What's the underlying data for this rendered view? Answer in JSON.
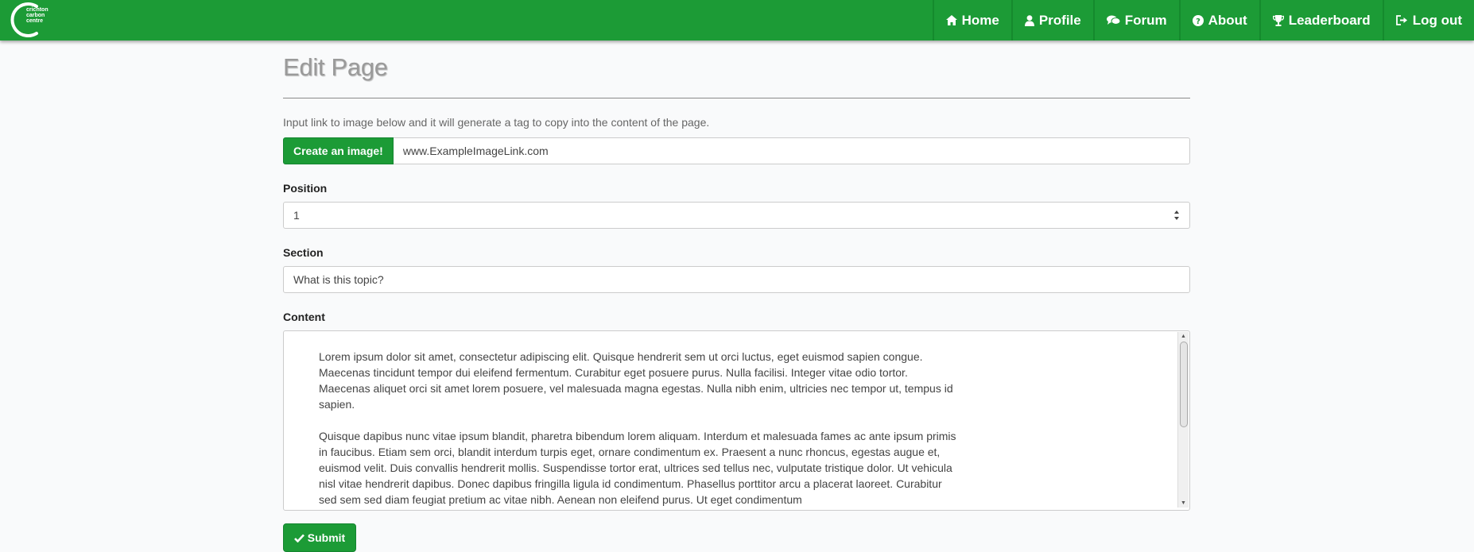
{
  "brand": {
    "logo_lines": [
      "crichton",
      "carbon",
      "centre"
    ],
    "accent_color": "#1c9b36"
  },
  "nav": {
    "items": [
      {
        "label": "Home",
        "icon": "home-icon"
      },
      {
        "label": "Profile",
        "icon": "user-icon"
      },
      {
        "label": "Forum",
        "icon": "comments-icon"
      },
      {
        "label": "About",
        "icon": "question-circle-icon"
      },
      {
        "label": "Leaderboard",
        "icon": "trophy-icon"
      },
      {
        "label": "Log out",
        "icon": "sign-out-icon"
      }
    ]
  },
  "page": {
    "title": "Edit Page",
    "hint": "Input link to image below and it will generate a tag to copy into the content of the page.",
    "create_image_button": "Create an image!",
    "image_link_value": "www.ExampleImageLink.com",
    "position_label": "Position",
    "position_value": "1",
    "section_label": "Section",
    "section_value": "What is this topic?",
    "content_label": "Content",
    "content_paragraphs": [
      "Lorem ipsum dolor sit amet, consectetur adipiscing elit. Quisque hendrerit sem ut orci luctus, eget euismod sapien congue. Maecenas tincidunt tempor dui eleifend fermentum. Curabitur eget posuere purus. Nulla facilisi. Integer vitae odio tortor. Maecenas aliquet orci sit amet lorem posuere, vel malesuada magna egestas. Nulla nibh enim, ultricies nec tempor ut, tempus id sapien.",
      "Quisque dapibus nunc vitae ipsum blandit, pharetra bibendum lorem aliquam. Interdum et malesuada fames ac ante ipsum primis in faucibus. Etiam sem orci, blandit interdum turpis eget, ornare condimentum ex. Praesent a nunc rhoncus, egestas augue et, euismod velit. Duis convallis hendrerit mollis. Suspendisse tortor erat, ultrices sed tellus nec, vulputate tristique dolor. Ut vehicula nisl vitae hendrerit dapibus. Donec dapibus fringilla ligula id condimentum. Phasellus porttitor arcu a placerat laoreet. Curabitur sed sem sed diam feugiat pretium ac vitae nibh. Aenean non eleifend purus. Ut eget condimentum"
    ],
    "submit_label": "Submit"
  }
}
